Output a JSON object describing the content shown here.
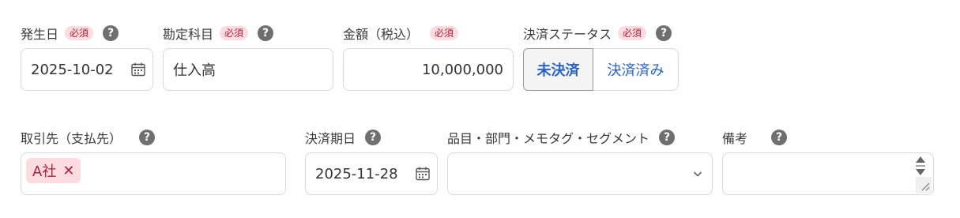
{
  "fields": {
    "date": {
      "label": "発生日",
      "required": "必須",
      "value": "2025-10-02"
    },
    "account": {
      "label": "勘定科目",
      "required": "必須",
      "value": "仕入高"
    },
    "amount": {
      "label": "金額（税込）",
      "required": "必須",
      "value": "10,000,000"
    },
    "settlement": {
      "label": "決済ステータス",
      "required": "必須",
      "options": [
        "未決済",
        "決済済み"
      ],
      "selected": "未決済"
    },
    "partner": {
      "label": "取引先（支払先）",
      "tag": "A社",
      "remove": "✕"
    },
    "due_date": {
      "label": "決済期日",
      "value": "2025-11-28"
    },
    "segments": {
      "label": "品目・部門・メモタグ・セグメント",
      "value": ""
    },
    "notes": {
      "label": "備考",
      "value": ""
    }
  },
  "help_glyph": "?",
  "colors": {
    "required_bg": "#fbdde1",
    "required_text": "#b0203a",
    "link_blue": "#2a63c4",
    "border": "#d8d8d8"
  },
  "icons": [
    "calendar-icon",
    "help-icon",
    "chevron-down-icon",
    "close-icon",
    "spinner-icon",
    "resize-grip-icon"
  ]
}
